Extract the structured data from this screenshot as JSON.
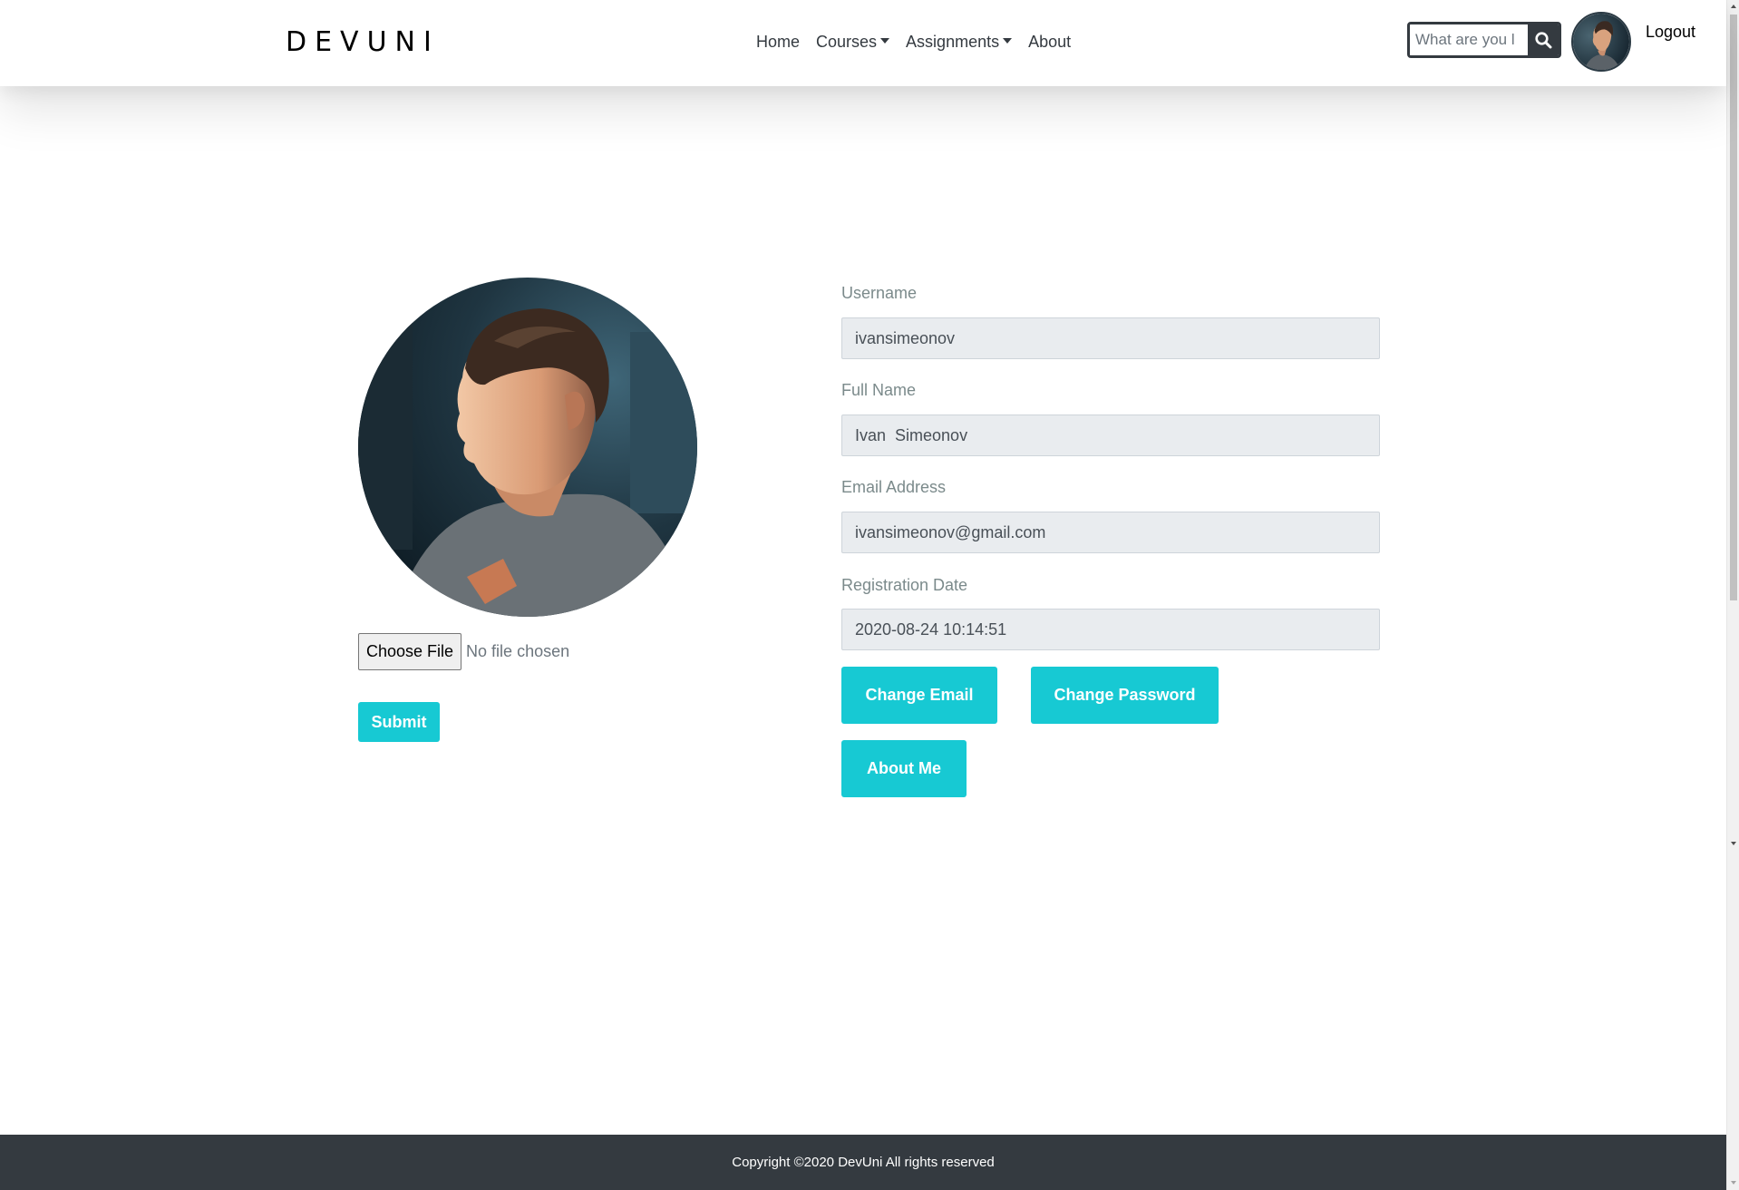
{
  "nav": {
    "brand": "DEVUNI",
    "links": [
      {
        "label": "Home",
        "has_dropdown": false
      },
      {
        "label": "Courses",
        "has_dropdown": true
      },
      {
        "label": "Assignments",
        "has_dropdown": true
      },
      {
        "label": "About",
        "has_dropdown": false
      }
    ],
    "search_placeholder": "What are you l",
    "search_icon": "search-icon",
    "logout_label": "Logout"
  },
  "profile": {
    "file_button_label": "Choose File",
    "file_status": "No file chosen",
    "submit_label": "Submit"
  },
  "fields": {
    "username": {
      "label": "Username",
      "value": "ivansimeonov"
    },
    "full_name": {
      "label": "Full Name",
      "value": "Ivan  Simeonov"
    },
    "email": {
      "label": "Email Address",
      "value": "ivansimeonov@gmail.com"
    },
    "registration_date": {
      "label": "Registration Date",
      "value": "2020-08-24 10:14:51"
    }
  },
  "actions": {
    "change_email": "Change Email",
    "change_password": "Change Password",
    "about_me": "About Me"
  },
  "footer": {
    "copyright": "Copyright ©2020 DevUni All rights reserved"
  },
  "colors": {
    "accent": "#17c9d3",
    "dark": "#343a40",
    "input_bg": "#e9ecef"
  }
}
